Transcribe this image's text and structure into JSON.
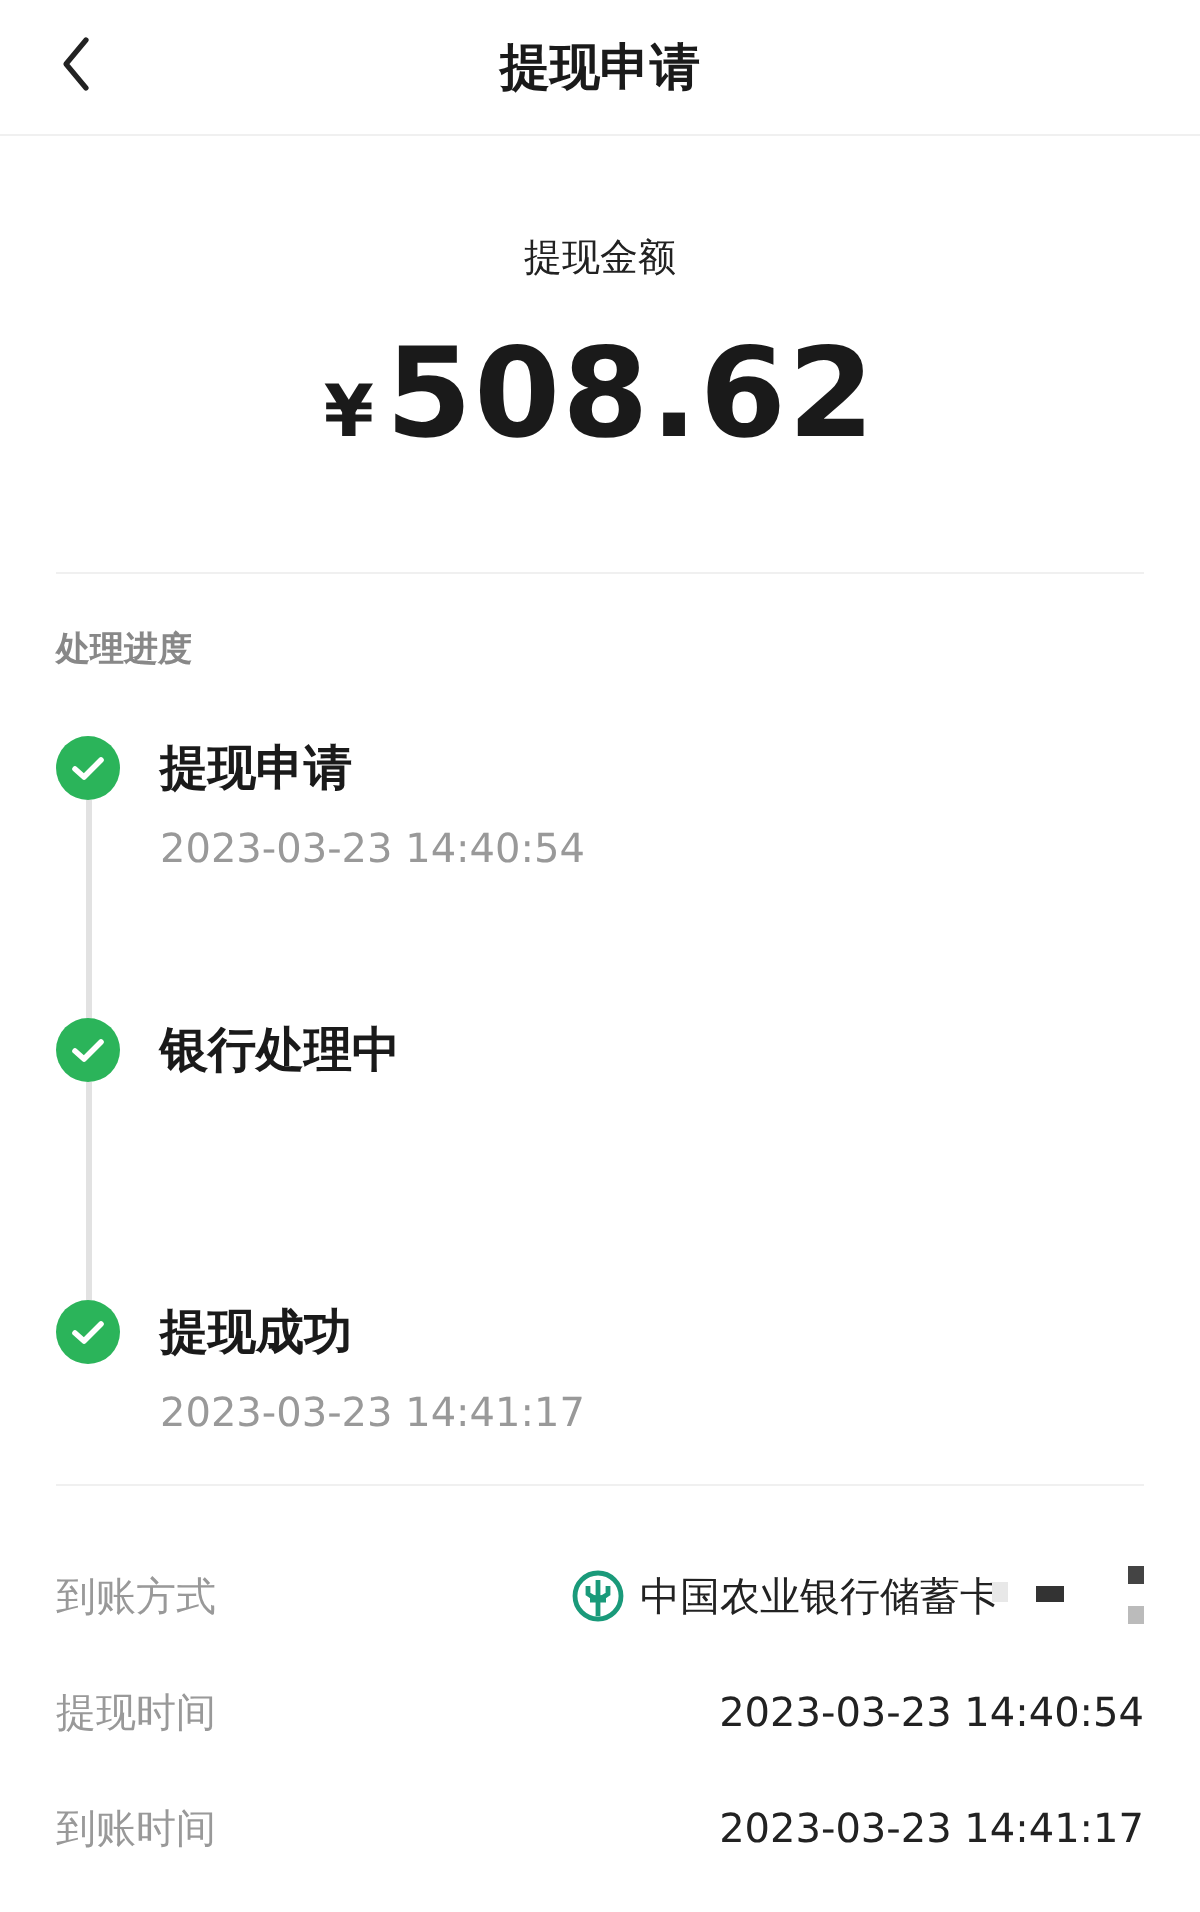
{
  "header": {
    "title": "提现申请"
  },
  "amount": {
    "label": "提现金额",
    "currency": "¥",
    "value": "508.62"
  },
  "progress": {
    "title": "处理进度",
    "steps": [
      {
        "title": "提现申请",
        "time": "2023-03-23 14:40:54",
        "done": true
      },
      {
        "title": "银行处理中",
        "done": true
      },
      {
        "title": "提现成功",
        "time": "2023-03-23 14:41:17",
        "done": true
      }
    ]
  },
  "details": [
    {
      "kind": "bank",
      "label": "到账方式",
      "value": "中国农业银行储蓄卡"
    },
    {
      "kind": "text",
      "label": "提现时间",
      "value": "2023-03-23 14:40:54"
    },
    {
      "kind": "text",
      "label": "到账时间",
      "value": "2023-03-23 14:41:17"
    }
  ]
}
